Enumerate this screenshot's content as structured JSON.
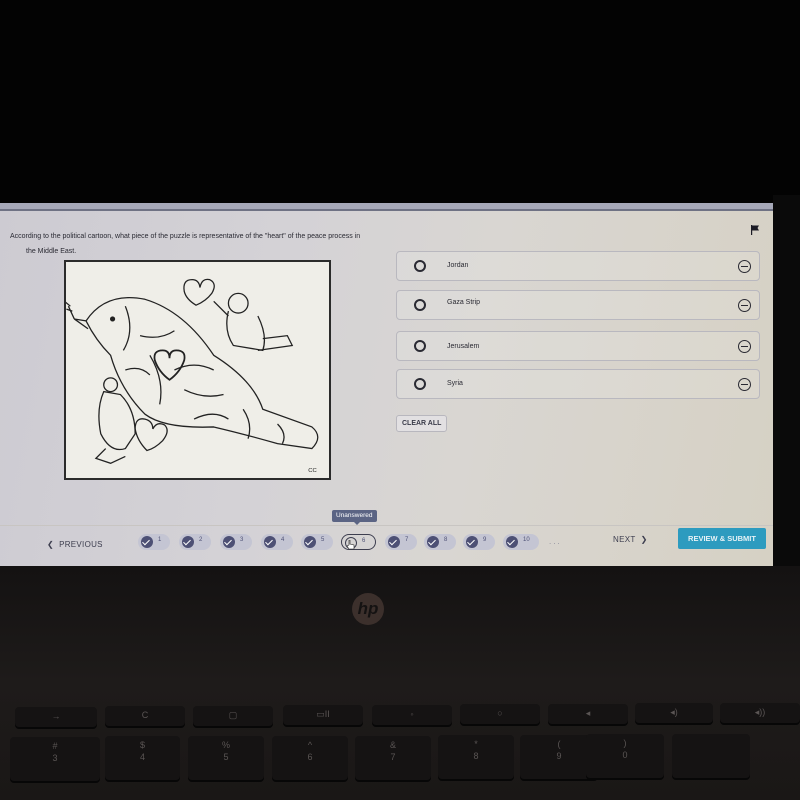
{
  "question": {
    "text_line1": "According to the political cartoon, what piece of the puzzle is representative of the \"heart\" of the peace process in",
    "text_line2": "the Middle East.",
    "flag_icon": "flag-icon"
  },
  "cartoon": {
    "description": "Political cartoon of a dove made of puzzle pieces with figures holding heart-shaped pieces",
    "signature": "CC"
  },
  "answers": [
    {
      "label": "Jordan",
      "selected": false
    },
    {
      "label": "Gaza Strip",
      "selected": false
    },
    {
      "label": "Jerusalem",
      "selected": false
    },
    {
      "label": "Syria",
      "selected": false
    }
  ],
  "clear_all_label": "CLEAR ALL",
  "navigation": {
    "previous_label": "PREVIOUS",
    "next_label": "NEXT",
    "review_submit_label": "REVIEW & SUBMIT",
    "tooltip": "Unanswered",
    "ellipsis": "...",
    "questions": [
      {
        "number": "1",
        "status": "answered"
      },
      {
        "number": "2",
        "status": "answered"
      },
      {
        "number": "3",
        "status": "answered"
      },
      {
        "number": "4",
        "status": "answered"
      },
      {
        "number": "5",
        "status": "answered"
      },
      {
        "number": "6",
        "status": "unanswered",
        "current": true
      },
      {
        "number": "7",
        "status": "answered"
      },
      {
        "number": "8",
        "status": "answered"
      },
      {
        "number": "9",
        "status": "answered"
      },
      {
        "number": "10",
        "status": "answered"
      }
    ],
    "accent_color": "#2d9bbf",
    "answered_color": "#4d5075"
  },
  "laptop": {
    "brand": "hp",
    "keys_row1": [
      "→",
      "C",
      "▢",
      "▭II",
      "◦",
      "○",
      "◂",
      "◂)",
      "◂))"
    ],
    "keys_row2": [
      {
        "top": "#",
        "bottom": "3"
      },
      {
        "top": "$",
        "bottom": "4"
      },
      {
        "top": "%",
        "bottom": "5"
      },
      {
        "top": "^",
        "bottom": "6"
      },
      {
        "top": "&",
        "bottom": "7"
      },
      {
        "top": "*",
        "bottom": "8"
      },
      {
        "top": "(",
        "bottom": "9"
      },
      {
        "top": ")",
        "bottom": "0"
      }
    ]
  }
}
